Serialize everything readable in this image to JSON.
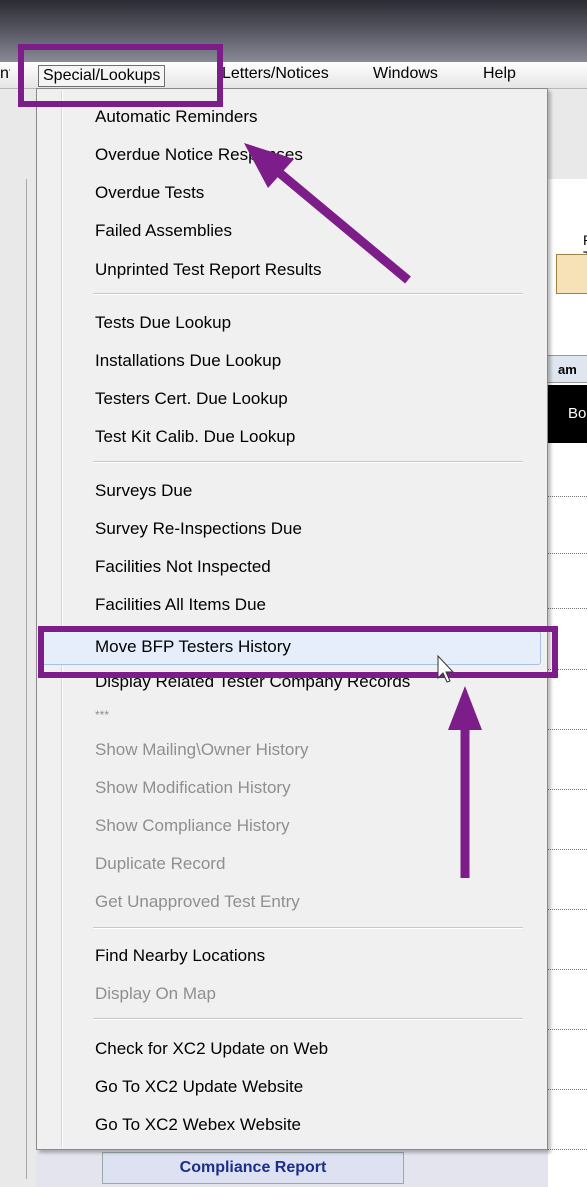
{
  "menubar": {
    "left_fragment": "nt",
    "special": "Special/Lookups",
    "letters": "Letters/Notices",
    "windows": "Windows",
    "help": "Help"
  },
  "background": {
    "panel_text": "P T",
    "header_text": "am",
    "dark_text": "Bo",
    "compliance_report": "Compliance Report"
  },
  "menu": {
    "group1": [
      "Automatic Reminders",
      "Overdue Notice Responses",
      "Overdue Tests",
      "Failed Assemblies",
      "Unprinted Test Report Results"
    ],
    "group2": [
      "Tests Due Lookup",
      "Installations Due Lookup",
      "Testers Cert. Due Lookup",
      "Test Kit Calib. Due Lookup"
    ],
    "group3": [
      "Surveys Due",
      "Survey Re-Inspections Due",
      "Facilities Not Inspected",
      "Facilities All Items Due"
    ],
    "group4": [
      "Move BFP Testers  History",
      "Display Related Tester Company Records",
      "***",
      "Show Mailing\\Owner History",
      "Show Modification History",
      "Show Compliance History",
      "Duplicate Record",
      "Get Unapproved Test Entry"
    ],
    "group5": [
      "Find Nearby Locations",
      "Display On Map"
    ],
    "group6": [
      "Check for XC2 Update on Web",
      "Go To XC2 Update Website",
      "Go To XC2 Webex Website"
    ]
  },
  "colors": {
    "annotation": "#7d1d89",
    "highlight": "#e5eefa",
    "disabled_text": "#8f8f8f"
  },
  "icons": {
    "cursor": "mouse-pointer-icon"
  }
}
